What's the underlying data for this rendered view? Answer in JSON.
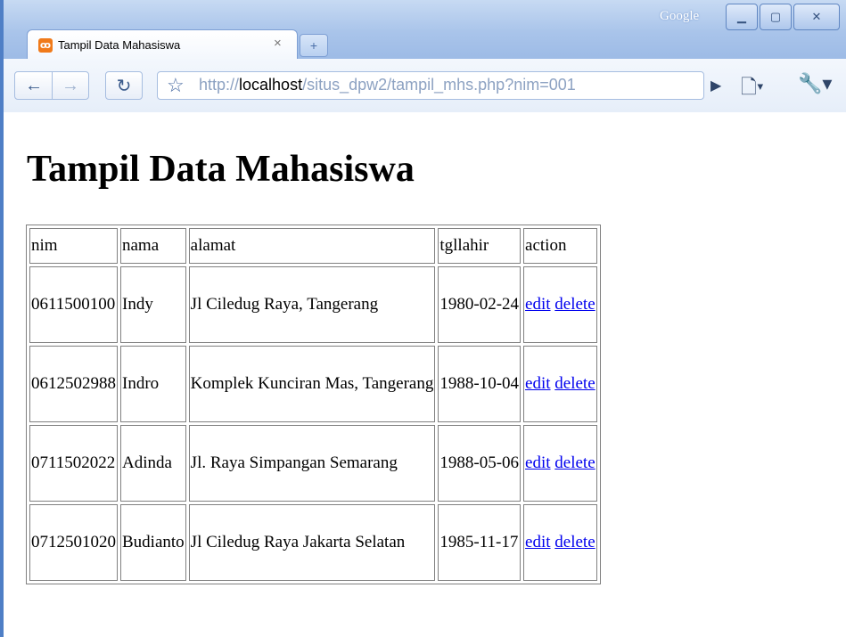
{
  "browser": {
    "google_label": "Google",
    "tab_title": "Tampil Data Mahasiswa",
    "address": {
      "prefix": "http://",
      "host": "localhost",
      "path": "/situs_dpw2/tampil_mhs.php?nim=001"
    }
  },
  "page": {
    "heading": "Tampil Data Mahasiswa"
  },
  "table": {
    "headers": [
      "nim",
      "nama",
      "alamat",
      "tgllahir",
      "action"
    ],
    "rows": [
      {
        "nim": "0611500100",
        "nama": "Indy",
        "alamat": "Jl Ciledug Raya, Tangerang",
        "tgllahir": "1980-02-24",
        "edit": "edit",
        "delete": "delete"
      },
      {
        "nim": "0612502988",
        "nama": "Indro",
        "alamat": "Komplek Kunciran Mas, Tangerang",
        "tgllahir": "1988-10-04",
        "edit": "edit",
        "delete": "delete"
      },
      {
        "nim": "0711502022",
        "nama": "Adinda",
        "alamat": "Jl. Raya Simpangan Semarang",
        "tgllahir": "1988-05-06",
        "edit": "edit",
        "delete": "delete"
      },
      {
        "nim": "0712501020",
        "nama": "Budianto",
        "alamat": "Jl Ciledug Raya Jakarta Selatan",
        "tgllahir": "1985-11-17",
        "edit": "edit",
        "delete": "delete"
      }
    ]
  }
}
